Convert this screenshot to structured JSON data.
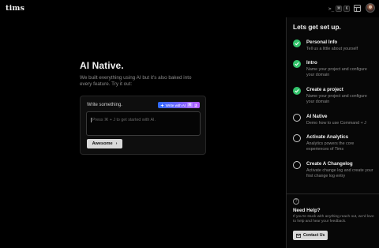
{
  "topbar": {
    "logo": "tims",
    "shortcut_terminal": ">_",
    "shortcut_keys": [
      "⌘",
      "K"
    ],
    "icons": [
      "terminal-icon",
      "layout-icon",
      "avatar"
    ]
  },
  "hero": {
    "title": "AI Native.",
    "subtitle": "We built everything using AI but it's also baked into every feature. Try it out:"
  },
  "write_card": {
    "label": "Write something.",
    "ai_button_label": "Write with AI",
    "ai_button_keys": [
      "⌘",
      "J"
    ],
    "placeholder": "Press ⌘ + J to get started with AI.",
    "submit_label": "Awesome",
    "submit_icon": "chevron-right-icon"
  },
  "sidebar": {
    "title": "Lets get set up.",
    "steps": [
      {
        "title": "Personal Info",
        "description": "Tell us a little about yourself",
        "done": true
      },
      {
        "title": "Intro",
        "description": "Name your project and configure your domain",
        "done": true
      },
      {
        "title": "Create a project",
        "description": "Name your project and configure your domain",
        "done": true
      },
      {
        "title": "AI Native",
        "description": "Demo how to use Command + J",
        "done": false
      },
      {
        "title": "Activate Analytics",
        "description": "Analytics powers the core experiences of Tims",
        "done": false
      },
      {
        "title": "Create A Changelog",
        "description": "Activate change log and create your first change log entry",
        "done": false
      }
    ],
    "help": {
      "title": "Need Help?",
      "text": "If you're stuck with anything reach out, we'd love to help and hear your feedback.",
      "button_label": "Contact Us",
      "button_icon": "mail-icon"
    }
  },
  "colors": {
    "background": "#000000",
    "accent_done": "#32c26a",
    "ai_gradient_start": "#2f6bff",
    "ai_gradient_end": "#b55cff"
  }
}
